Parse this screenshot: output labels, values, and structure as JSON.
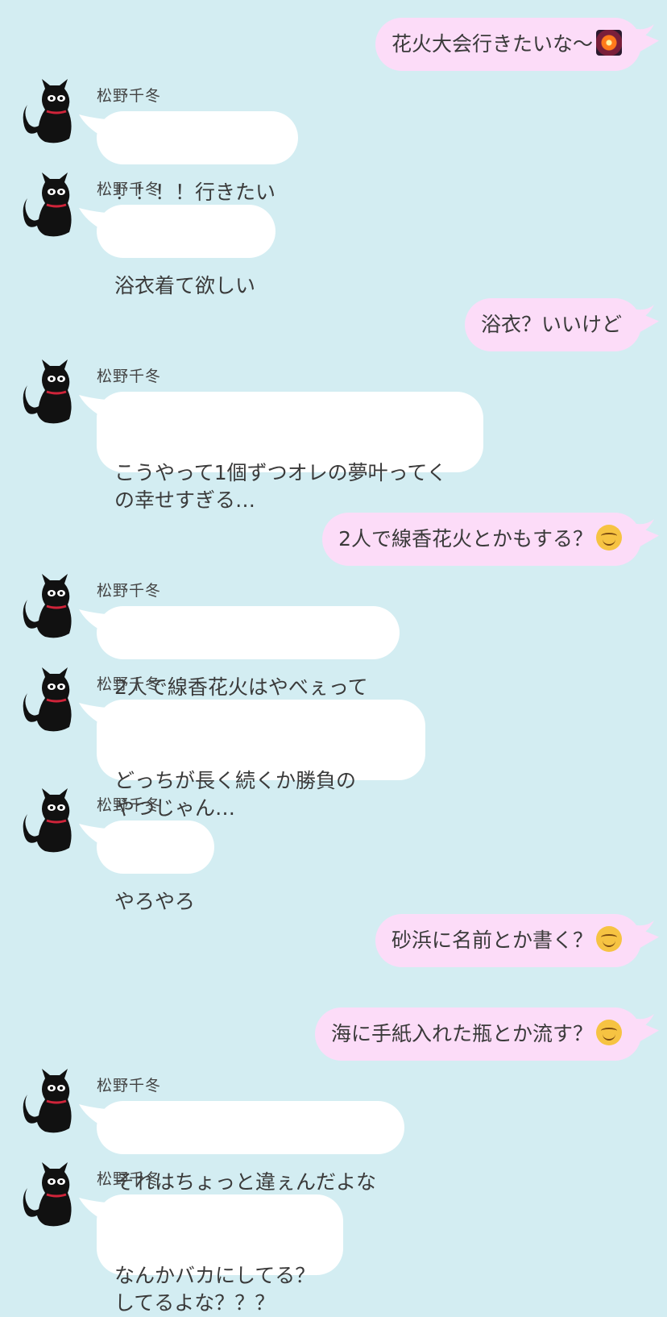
{
  "contact": {
    "name": "松野千冬"
  },
  "colors": {
    "background": "#d3edf2",
    "sent_bubble": "#fcdcf8",
    "received_bubble": "#ffffff"
  },
  "messages": [
    {
      "side": "right",
      "text": "花火大会行きたいな〜",
      "emoji": "firework-emoji"
    },
    {
      "side": "left",
      "sender": "松野千冬",
      "text": "！！！！行きたい"
    },
    {
      "side": "left",
      "sender": "松野千冬",
      "text": "浴衣着て欲しい"
    },
    {
      "side": "right",
      "text": "浴衣？いいけど"
    },
    {
      "side": "left",
      "sender": "松野千冬",
      "text": "こうやって1個ずつオレの夢叶ってく\nの幸せすぎる…"
    },
    {
      "side": "right",
      "text": "2人で線香花火とかもする？",
      "emoji": "smiling-face-emoji"
    },
    {
      "side": "left",
      "sender": "松野千冬",
      "text": "2人で線香花火はやべぇって"
    },
    {
      "side": "left",
      "sender": "松野千冬",
      "text": "どっちが長く続くか勝負の\nやつじゃん…"
    },
    {
      "side": "left",
      "sender": "松野千冬",
      "text": "やろやろ"
    },
    {
      "side": "right",
      "text": "砂浜に名前とか書く？",
      "emoji": "smiling-face-emoji"
    },
    {
      "side": "right",
      "text": "海に手紙入れた瓶とか流す？",
      "emoji": "smiling-face-emoji"
    },
    {
      "side": "left",
      "sender": "松野千冬",
      "text": "それはちょっと違ぇんだよな"
    },
    {
      "side": "left",
      "sender": "松野千冬",
      "text": "なんかバカにしてる？\nしてるよな？？？"
    }
  ]
}
